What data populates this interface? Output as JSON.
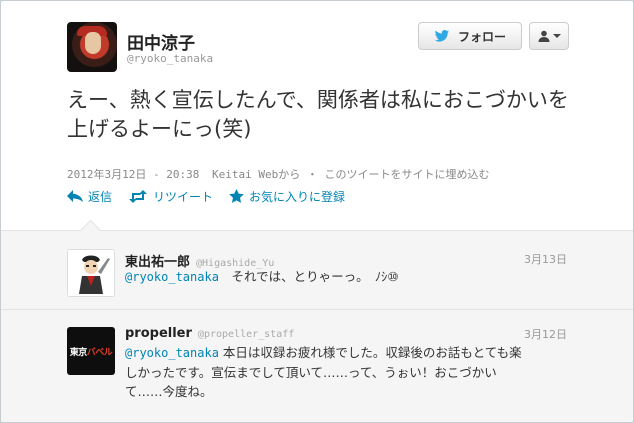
{
  "author": {
    "display_name": "田中涼子",
    "handle": "@ryoko_tanaka"
  },
  "buttons": {
    "follow_label": "フォロー"
  },
  "tweet": {
    "text": "えー、熱く宣伝したんで、関係者は私におこづかいを上げるよーにっ(笑)",
    "date": "2012年3月12日 - 20:38",
    "source": "Keitai Webから",
    "separator": "・",
    "embed_link": "このツイートをサイトに埋め込む"
  },
  "actions": {
    "reply": "返信",
    "retweet": "リツイート",
    "favorite": "お気に入りに登録"
  },
  "replies": [
    {
      "name": "東出祐一郎",
      "handle": "@Higashide_Yu",
      "date": "3月13日",
      "mention": "@ryoko_tanaka",
      "text": "それでは、とりゃーっ。　ﾉｼ⑩"
    },
    {
      "name": "propeller",
      "handle": "@propeller_staff",
      "date": "3月12日",
      "mention": "@ryoko_tanaka",
      "text_line1": "本日は収録お疲れ様でした。収録後のお話もとても楽",
      "text_line2": "しかったです。宣伝までして頂いて……って、うぉい！おこづかい",
      "text_line3": "て……今度ね。",
      "avatar_logo_white": "東京",
      "avatar_logo_red": "バベル"
    }
  ],
  "colors": {
    "link": "#0084b4",
    "reply_bg": "#f5f5f5",
    "page_bg": "#c9d3d9"
  }
}
